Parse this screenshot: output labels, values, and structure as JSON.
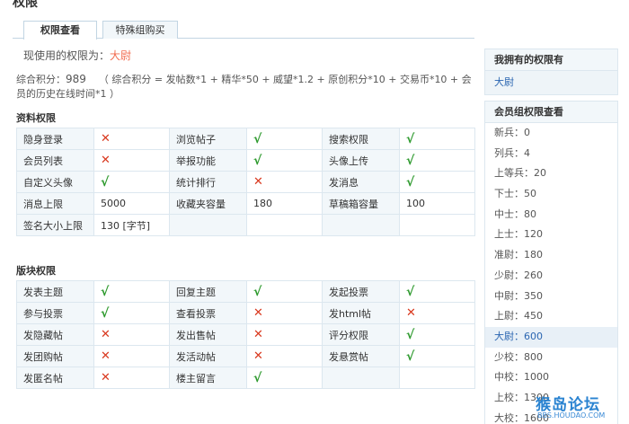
{
  "page": {
    "title": "权限"
  },
  "tabs": [
    {
      "label": "权限查看",
      "active": true
    },
    {
      "label": "特殊组购买",
      "active": false
    }
  ],
  "current": {
    "prefix": "现使用的权限为：",
    "rank": "大尉"
  },
  "credits": {
    "label": "综合积分：",
    "value": "989",
    "formula": "（ 综合积分 = 发帖数*1 + 精华*50 + 威望*1.2 + 原创积分*10 + 交易币*10 + 会员的历史在线时间*1 ）"
  },
  "sections": {
    "profile": {
      "title": "资料权限",
      "rows": [
        [
          {
            "label": "隐身登录",
            "value": "✕",
            "type": "no"
          },
          {
            "label": "浏览帖子",
            "value": "√",
            "type": "yes"
          },
          {
            "label": "搜索权限",
            "value": "√",
            "type": "yes"
          }
        ],
        [
          {
            "label": "会员列表",
            "value": "✕",
            "type": "no"
          },
          {
            "label": "举报功能",
            "value": "√",
            "type": "yes"
          },
          {
            "label": "头像上传",
            "value": "√",
            "type": "yes"
          }
        ],
        [
          {
            "label": "自定义头像",
            "value": "√",
            "type": "yes"
          },
          {
            "label": "统计排行",
            "value": "✕",
            "type": "no"
          },
          {
            "label": "发消息",
            "value": "√",
            "type": "yes"
          }
        ],
        [
          {
            "label": "消息上限",
            "value": "5000",
            "type": "text"
          },
          {
            "label": "收藏夹容量",
            "value": "180",
            "type": "text"
          },
          {
            "label": "草稿箱容量",
            "value": "100",
            "type": "text"
          }
        ],
        [
          {
            "label": "签名大小上限",
            "value": "130 [字节]",
            "type": "text"
          },
          {
            "label": "",
            "value": "",
            "type": "text"
          },
          {
            "label": "",
            "value": "",
            "type": "text"
          }
        ]
      ]
    },
    "board": {
      "title": "版块权限",
      "rows": [
        [
          {
            "label": "发表主题",
            "value": "√",
            "type": "yes"
          },
          {
            "label": "回复主题",
            "value": "√",
            "type": "yes"
          },
          {
            "label": "发起投票",
            "value": "√",
            "type": "yes"
          }
        ],
        [
          {
            "label": "参与投票",
            "value": "√",
            "type": "yes"
          },
          {
            "label": "查看投票",
            "value": "✕",
            "type": "no"
          },
          {
            "label": "发html帖",
            "value": "✕",
            "type": "no"
          }
        ],
        [
          {
            "label": "发隐藏帖",
            "value": "✕",
            "type": "no"
          },
          {
            "label": "发出售帖",
            "value": "✕",
            "type": "no"
          },
          {
            "label": "评分权限",
            "value": "√",
            "type": "yes"
          }
        ],
        [
          {
            "label": "发团购帖",
            "value": "✕",
            "type": "no"
          },
          {
            "label": "发活动帖",
            "value": "✕",
            "type": "no"
          },
          {
            "label": "发悬赏帖",
            "value": "√",
            "type": "yes"
          }
        ],
        [
          {
            "label": "发匿名帖",
            "value": "✕",
            "type": "no"
          },
          {
            "label": "楼主留言",
            "value": "√",
            "type": "yes"
          },
          {
            "label": "",
            "value": "",
            "type": "text"
          }
        ]
      ]
    }
  },
  "sidebar": {
    "owned": {
      "title": "我拥有的权限有",
      "value": "大尉"
    },
    "groups": {
      "title": "会员组权限查看",
      "items": [
        {
          "label": "新兵：0",
          "highlight": false
        },
        {
          "label": "列兵：4",
          "highlight": false
        },
        {
          "label": "上等兵：20",
          "highlight": false
        },
        {
          "label": "下士：50",
          "highlight": false
        },
        {
          "label": "中士：80",
          "highlight": false
        },
        {
          "label": "上士：120",
          "highlight": false
        },
        {
          "label": "准尉：180",
          "highlight": false
        },
        {
          "label": "少尉：260",
          "highlight": false
        },
        {
          "label": "中尉：350",
          "highlight": false
        },
        {
          "label": "上尉：450",
          "highlight": false
        },
        {
          "label": "大尉：600",
          "highlight": true
        },
        {
          "label": "少校：800",
          "highlight": false
        },
        {
          "label": "中校：1000",
          "highlight": false
        },
        {
          "label": "上校：1300",
          "highlight": false
        },
        {
          "label": "大校：1600",
          "highlight": false
        }
      ]
    }
  },
  "watermark": {
    "main": "猴岛论坛",
    "sub": "BBS.HOUDAO.COM"
  },
  "colors": {
    "yes": "#2e9a2e",
    "no": "#d9381e",
    "link": "#2b66b1",
    "rank": "#f26c4f"
  }
}
